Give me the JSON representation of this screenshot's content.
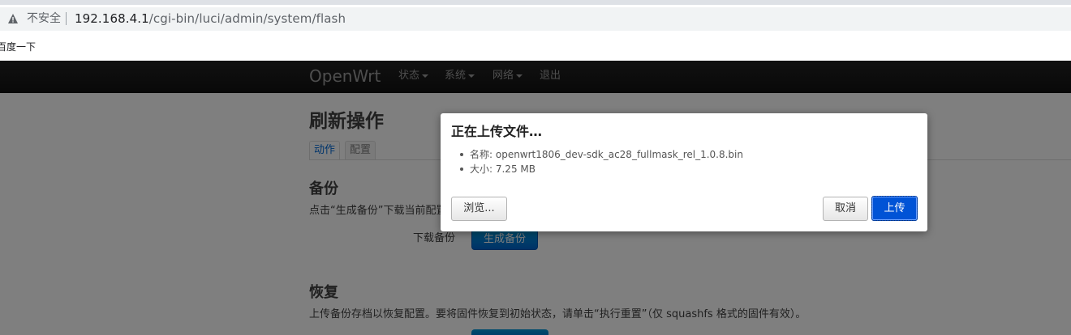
{
  "browser": {
    "security_label": "不安全",
    "url_host": "192.168.4.1",
    "url_path": "/cgi-bin/luci/admin/system/flash",
    "bookmark": "百度一下"
  },
  "navbar": {
    "brand": "OpenWrt",
    "items": [
      {
        "label": "状态",
        "dropdown": true
      },
      {
        "label": "系统",
        "dropdown": true
      },
      {
        "label": "网络",
        "dropdown": true
      },
      {
        "label": "退出",
        "dropdown": false
      }
    ]
  },
  "main": {
    "title": "刷新操作",
    "tabs": [
      {
        "label": "动作",
        "active": true
      },
      {
        "label": "配置",
        "active": false
      }
    ],
    "backup": {
      "heading": "备份",
      "description": "点击“生成备份”下载当前配置",
      "row_label": "下载备份",
      "button": "生成备份"
    },
    "restore": {
      "heading": "恢复",
      "description": "上传备份存档以恢复配置。要将固件恢复到初始状态，请单击“执行重置”（仅 squashfs 格式的固件有效）。"
    }
  },
  "modal": {
    "title": "正在上传文件…",
    "items": [
      "名称: openwrt1806_dev-sdk_ac28_fullmask_rel_1.0.8.bin",
      "大小: 7.25 MB"
    ],
    "browse_label": "浏览...",
    "cancel_label": "取消",
    "upload_label": "上传"
  },
  "colors": {
    "accent": "#0053d6",
    "navbar": "#111111"
  },
  "icons": {
    "security": "warning-triangle-icon"
  }
}
